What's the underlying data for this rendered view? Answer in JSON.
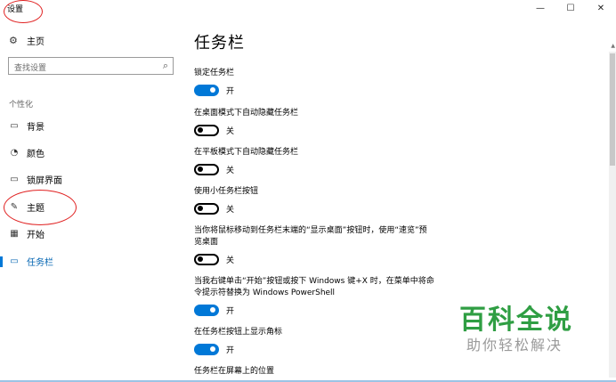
{
  "window": {
    "title": "设置",
    "minimize_glyph": "—",
    "maximize_glyph": "☐",
    "close_glyph": "✕"
  },
  "sidebar": {
    "home_icon": "gear-icon",
    "home_label": "主页",
    "search_placeholder": "查找设置",
    "section_label": "个性化",
    "items": [
      {
        "icon": "picture-icon",
        "glyph": "▭",
        "label": "背景"
      },
      {
        "icon": "palette-icon",
        "glyph": "◔",
        "label": "颜色"
      },
      {
        "icon": "lock-screen-icon",
        "glyph": "▭",
        "label": "锁屏界面"
      },
      {
        "icon": "theme-icon",
        "glyph": "✎",
        "label": "主题"
      },
      {
        "icon": "start-icon",
        "glyph": "▦",
        "label": "开始"
      },
      {
        "icon": "taskbar-icon",
        "glyph": "▭",
        "label": "任务栏",
        "active": true
      }
    ]
  },
  "main": {
    "title": "任务栏",
    "settings": [
      {
        "label": "锁定任务栏",
        "state": "on",
        "state_label": "开"
      },
      {
        "label": "在桌面模式下自动隐藏任务栏",
        "state": "off",
        "state_label": "关"
      },
      {
        "label": "在平板模式下自动隐藏任务栏",
        "state": "off",
        "state_label": "关"
      },
      {
        "label": "使用小任务栏按钮",
        "state": "off",
        "state_label": "关"
      },
      {
        "label_line1": "当你将鼠标移动到任务栏末端的“显示桌面”按钮时，使用“速览”预",
        "label_line2": "览桌面",
        "state": "off",
        "state_label": "关"
      },
      {
        "label_line1": "当我右键单击“开始”按钮或按下 Windows 键+X 时，在菜单中将命",
        "label_line2": "令提示符替换为 Windows PowerShell",
        "state": "on",
        "state_label": "开"
      },
      {
        "label": "在任务栏按钮上显示角标",
        "state": "on",
        "state_label": "开"
      }
    ],
    "next_section_label": "任务栏在屏幕上的位置"
  },
  "watermark": {
    "title": "百科全说",
    "subtitle": "助你轻松解决"
  },
  "colors": {
    "accent": "#0078d7",
    "annotation": "#e02020",
    "watermark_green": "#2f9e43"
  }
}
